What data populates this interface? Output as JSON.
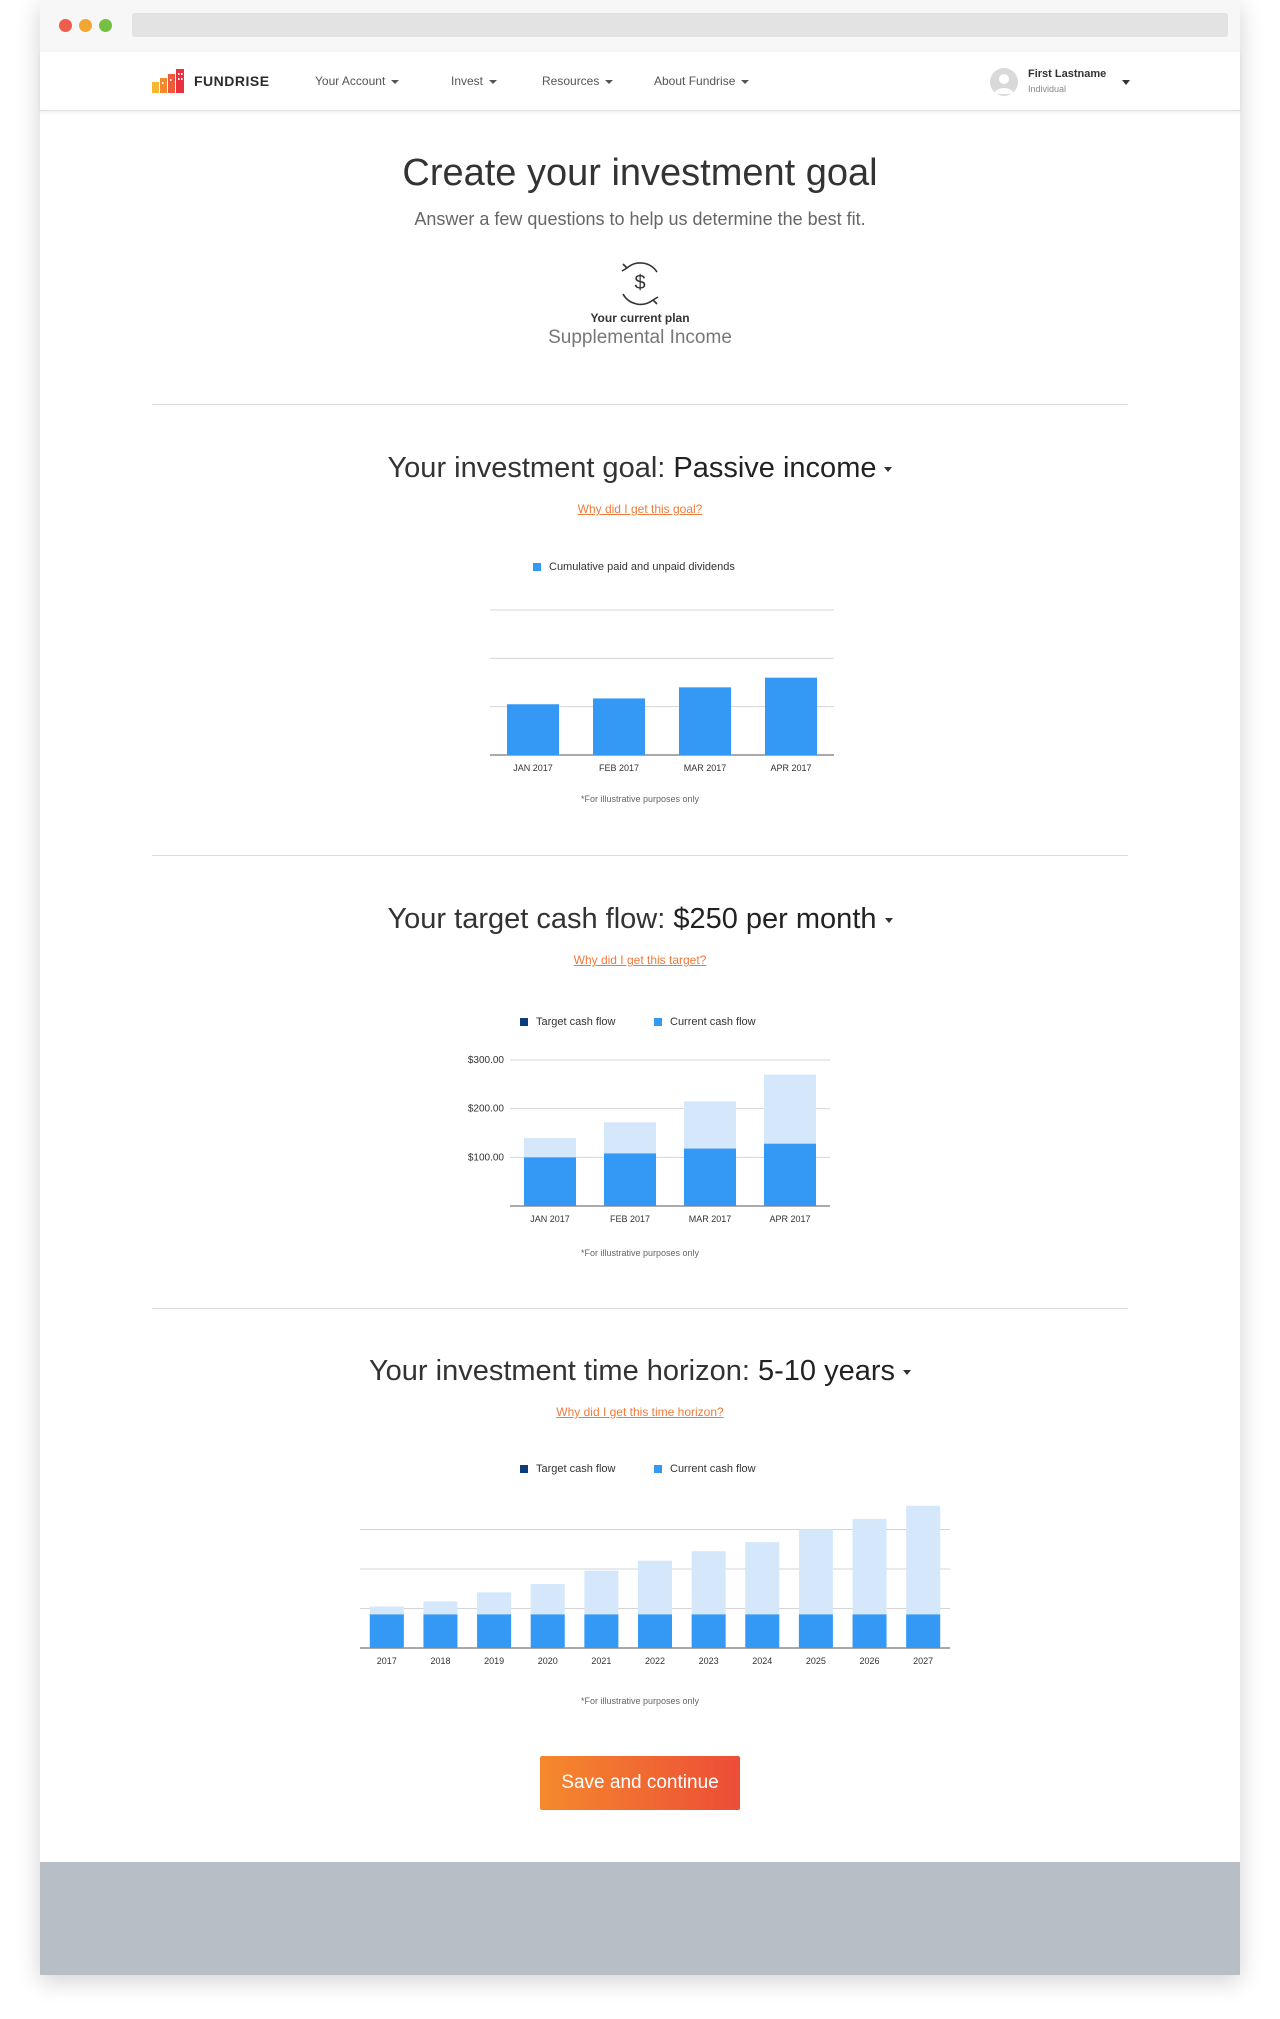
{
  "app": {
    "brand": "FUNDRISE"
  },
  "nav": {
    "items": [
      {
        "label": "Your Account"
      },
      {
        "label": "Invest"
      },
      {
        "label": "Resources"
      },
      {
        "label": "About Fundrise"
      }
    ],
    "user": {
      "name": "First Lastname",
      "type": "Individual"
    }
  },
  "header": {
    "title": "Create your investment goal",
    "subtitle": "Answer a few questions to help us determine the best fit.",
    "plan_label": "Your current plan",
    "plan_value": "Supplemental Income"
  },
  "goal": {
    "prefix": "Your investment goal:",
    "value": "Passive income",
    "link": "Why did I get this goal?",
    "note": "*For illustrative purposes only"
  },
  "cashflow": {
    "prefix": "Your target cash flow:",
    "value": "$250 per month",
    "link": "Why did I get this target?",
    "note": "*For illustrative purposes only"
  },
  "horizon": {
    "prefix": "Your investment time horizon:",
    "value": "5-10 years",
    "link": "Why did I get this time horizon?",
    "note": "*For illustrative purposes only"
  },
  "save_label": "Save and continue",
  "colors": {
    "accent": "#f07a3a",
    "bar": "#3399f5",
    "bar_light": "#d5e8fb",
    "dark": "#0b3d7a"
  },
  "chart_data": [
    {
      "type": "bar",
      "categories": [
        "JAN 2017",
        "FEB 2017",
        "MAR 2017",
        "APR 2017"
      ],
      "series": [
        {
          "name": "Cumulative paid and unpaid dividends",
          "values": [
            105,
            117,
            140,
            160
          ]
        }
      ],
      "ylim": [
        0,
        300
      ],
      "grid": true,
      "legend": "top-center"
    },
    {
      "type": "bar",
      "categories": [
        "JAN 2017",
        "FEB 2017",
        "MAR 2017",
        "APR 2017"
      ],
      "series": [
        {
          "name": "Target cash flow",
          "values": [
            140,
            172,
            215,
            270
          ]
        },
        {
          "name": "Current cash flow",
          "values": [
            100,
            108,
            118,
            128
          ]
        }
      ],
      "yticks": [
        "$100.00",
        "$200.00",
        "$300.00"
      ],
      "ylim": [
        0,
        300
      ],
      "grid": true,
      "legend": "top-center"
    },
    {
      "type": "bar",
      "categories": [
        "2017",
        "2018",
        "2019",
        "2020",
        "2021",
        "2022",
        "2023",
        "2024",
        "2025",
        "2026",
        "2027"
      ],
      "series": [
        {
          "name": "Target cash flow",
          "values": [
            105,
            118,
            141,
            162,
            196,
            221,
            245,
            268,
            300,
            327,
            360
          ]
        },
        {
          "name": "Current cash flow",
          "values": [
            85,
            85,
            85,
            85,
            85,
            85,
            85,
            85,
            85,
            85,
            85
          ]
        }
      ],
      "ylim": [
        0,
        400
      ],
      "grid": true,
      "legend": "top-center"
    }
  ]
}
